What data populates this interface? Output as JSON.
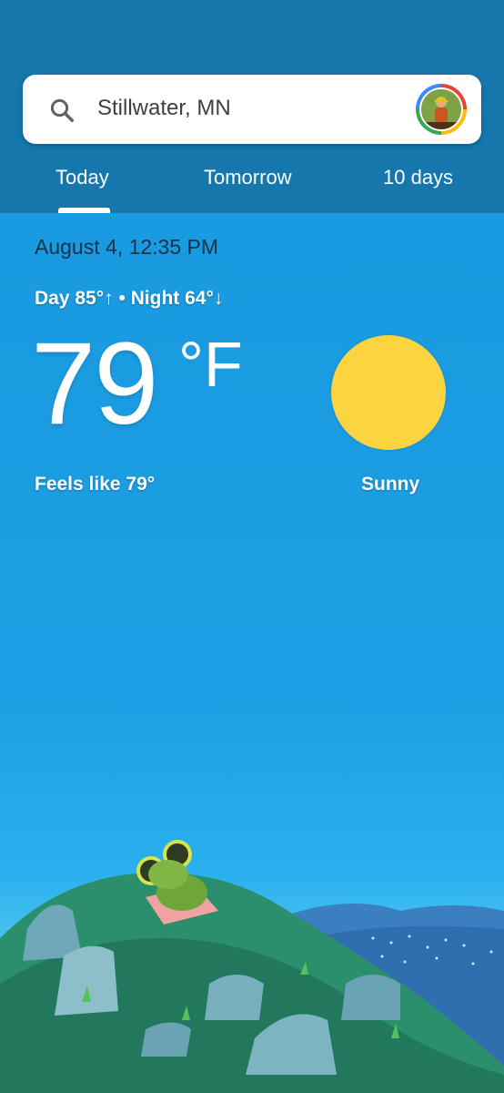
{
  "search": {
    "value": "Stillwater, MN"
  },
  "tabs": [
    {
      "label": "Today"
    },
    {
      "label": "Tomorrow"
    },
    {
      "label": "10 days"
    }
  ],
  "weather": {
    "datetime": "August 4, 12:35 PM",
    "day_night": "Day 85°↑ • Night 64°↓",
    "temperature": "79",
    "unit": "°F",
    "feels_like": "Feels like 79°",
    "condition": "Sunny",
    "condition_icon": "sun-icon"
  },
  "colors": {
    "header": "#1677ad",
    "sky": "#1a9ae0",
    "sun": "#fcd43f"
  },
  "illustration": "frog-on-hill"
}
